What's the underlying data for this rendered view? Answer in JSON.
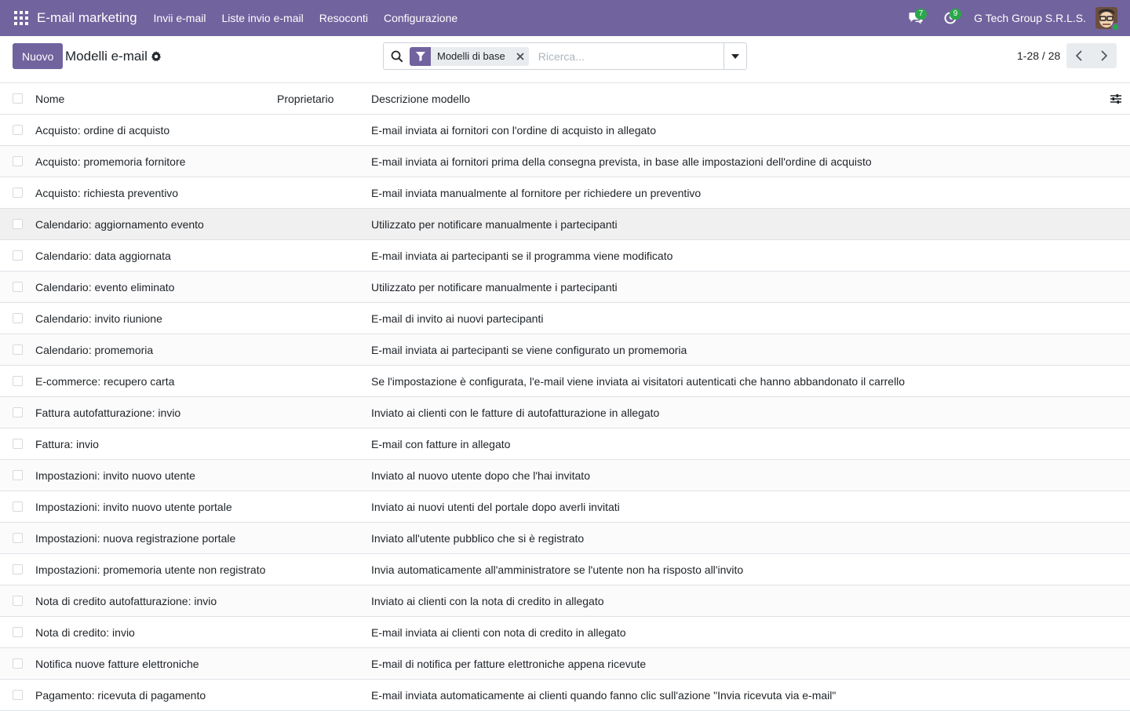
{
  "navbar": {
    "brand": "E-mail marketing",
    "menu": [
      "Invii e-mail",
      "Liste invio e-mail",
      "Resoconti",
      "Configurazione"
    ],
    "messages_count": "7",
    "activities_count": "9",
    "company": "G Tech Group S.R.L.S.",
    "accent_color": "#71639e"
  },
  "control_panel": {
    "new_label": "Nuovo",
    "title": "Modelli e-mail",
    "facet_label": "Modelli di base",
    "search_placeholder": "Ricerca...",
    "pager": "1-28 / 28"
  },
  "table": {
    "columns": {
      "name": "Nome",
      "owner": "Proprietario",
      "description": "Descrizione modello"
    },
    "rows": [
      {
        "name": "Acquisto: ordine di acquisto",
        "owner": "",
        "description": "E-mail inviata ai fornitori con l'ordine di acquisto in allegato"
      },
      {
        "name": "Acquisto: promemoria fornitore",
        "owner": "",
        "description": "E-mail inviata ai fornitori prima della consegna prevista, in base alle impostazioni dell'ordine di acquisto"
      },
      {
        "name": "Acquisto: richiesta preventivo",
        "owner": "",
        "description": "E-mail inviata manualmente al fornitore per richiedere un preventivo"
      },
      {
        "name": "Calendario: aggiornamento evento",
        "owner": "",
        "description": "Utilizzato per notificare manualmente i partecipanti"
      },
      {
        "name": "Calendario: data aggiornata",
        "owner": "",
        "description": "E-mail inviata ai partecipanti se il programma viene modificato"
      },
      {
        "name": "Calendario: evento eliminato",
        "owner": "",
        "description": "Utilizzato per notificare manualmente i partecipanti"
      },
      {
        "name": "Calendario: invito riunione",
        "owner": "",
        "description": "E-mail di invito ai nuovi partecipanti"
      },
      {
        "name": "Calendario: promemoria",
        "owner": "",
        "description": "E-mail inviata ai partecipanti se viene configurato un promemoria"
      },
      {
        "name": "E-commerce: recupero carta",
        "owner": "",
        "description": "Se l'impostazione è configurata, l'e-mail viene inviata ai visitatori autenticati che hanno abbandonato il carrello"
      },
      {
        "name": "Fattura autofatturazione: invio",
        "owner": "",
        "description": "Inviato ai clienti con le fatture di autofatturazione in allegato"
      },
      {
        "name": "Fattura: invio",
        "owner": "",
        "description": "E-mail con fatture in allegato"
      },
      {
        "name": "Impostazioni: invito nuovo utente",
        "owner": "",
        "description": "Inviato al nuovo utente dopo che l'hai invitato"
      },
      {
        "name": "Impostazioni: invito nuovo utente portale",
        "owner": "",
        "description": "Inviato ai nuovi utenti del portale dopo averli invitati"
      },
      {
        "name": "Impostazioni: nuova registrazione portale",
        "owner": "",
        "description": "Inviato all'utente pubblico che si è registrato"
      },
      {
        "name": "Impostazioni: promemoria utente non registrato",
        "owner": "",
        "description": "Invia automaticamente all'amministratore se l'utente non ha risposto all'invito"
      },
      {
        "name": "Nota di credito autofatturazione: invio",
        "owner": "",
        "description": "Inviato ai clienti con la nota di credito in allegato"
      },
      {
        "name": "Nota di credito: invio",
        "owner": "",
        "description": "E-mail inviata ai clienti con nota di credito in allegato"
      },
      {
        "name": "Notifica nuove fatture elettroniche",
        "owner": "",
        "description": "E-mail di notifica per fatture elettroniche appena ricevute"
      },
      {
        "name": "Pagamento: ricevuta di pagamento",
        "owner": "",
        "description": "E-mail inviata automaticamente ai clienti quando fanno clic sull'azione \"Invia ricevuta via e-mail\""
      }
    ]
  }
}
